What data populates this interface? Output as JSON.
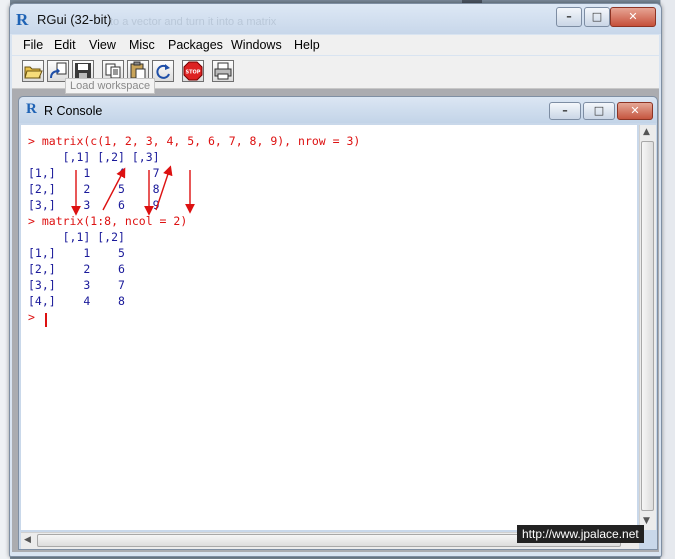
{
  "window": {
    "title": "RGui (32-bit)",
    "ghost_title": "to a vector and turn it into a matrix",
    "controls": {
      "minimize": "–",
      "maximize": "□",
      "close": "✕"
    }
  },
  "menu": [
    "File",
    "Edit",
    "View",
    "Misc",
    "Packages",
    "Windows",
    "Help"
  ],
  "toolbar": {
    "buttons": [
      "open-script-icon",
      "load-workspace-icon",
      "save-workspace-icon",
      "copy-icon",
      "paste-icon",
      "refresh-icon",
      "stop-icon",
      "print-icon"
    ],
    "stop_label": "STOP",
    "tooltip": "Load workspace"
  },
  "console": {
    "title": "R Console",
    "lines": [
      {
        "text": "> matrix(c(1, 2, 3, 4, 5, 6, 7, 8, 9), nrow = 3)",
        "kind": "cmd"
      },
      {
        "text": "     [,1] [,2] [,3]",
        "kind": "out"
      },
      {
        "text": "[1,]    1    4    7",
        "kind": "out"
      },
      {
        "text": "[2,]    2    5    8",
        "kind": "out"
      },
      {
        "text": "[3,]    3    6    9",
        "kind": "out"
      },
      {
        "text": "> matrix(1:8, ncol = 2)",
        "kind": "cmd"
      },
      {
        "text": "     [,1] [,2]",
        "kind": "out"
      },
      {
        "text": "[1,]    1    5",
        "kind": "out"
      },
      {
        "text": "[2,]    2    6",
        "kind": "out"
      },
      {
        "text": "[3,]    3    7",
        "kind": "out"
      },
      {
        "text": "[4,]    4    8",
        "kind": "out"
      },
      {
        "text": "> ",
        "kind": "cmd"
      }
    ]
  },
  "watermark": "http://www.jpalace.net",
  "colors": {
    "command": "#dd1111",
    "output": "#1a1a9a",
    "annotation_arrows": "#dd1111"
  }
}
